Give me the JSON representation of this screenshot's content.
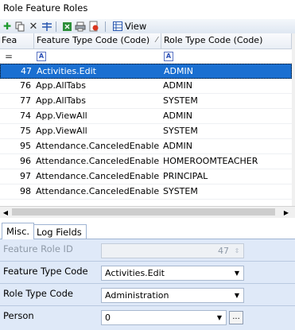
{
  "window": {
    "title": "Role Feature Roles"
  },
  "toolbar": {
    "view_label": "View"
  },
  "grid": {
    "headers": {
      "id": "Fea",
      "feature_type": "Feature Type Code (Code)",
      "role_type": "Role Type Code (Code)"
    },
    "filter": {
      "id": "=",
      "feature_type": "A",
      "role_type": "A"
    },
    "rows": [
      {
        "id": "47",
        "feature": "Activities.Edit",
        "role": "ADMIN",
        "selected": true
      },
      {
        "id": "76",
        "feature": "App.AllTabs",
        "role": "ADMIN"
      },
      {
        "id": "77",
        "feature": "App.AllTabs",
        "role": "SYSTEM"
      },
      {
        "id": "74",
        "feature": "App.ViewAll",
        "role": "ADMIN"
      },
      {
        "id": "75",
        "feature": "App.ViewAll",
        "role": "SYSTEM"
      },
      {
        "id": "95",
        "feature": "Attendance.CanceledEnabled",
        "role": "ADMIN"
      },
      {
        "id": "96",
        "feature": "Attendance.CanceledEnabled",
        "role": "HOMEROOMTEACHER"
      },
      {
        "id": "97",
        "feature": "Attendance.CanceledEnabled",
        "role": "PRINCIPAL"
      },
      {
        "id": "98",
        "feature": "Attendance.CanceledEnabled",
        "role": "SYSTEM"
      }
    ]
  },
  "tabs": {
    "misc": "Misc.",
    "log_fields": "Log Fields"
  },
  "form": {
    "feature_role_id": {
      "label": "Feature Role ID",
      "value": "47"
    },
    "feature_type_code": {
      "label": "Feature Type Code",
      "value": "Activities.Edit"
    },
    "role_type_code": {
      "label": "Role Type Code",
      "value": "Administration"
    },
    "person": {
      "label": "Person",
      "value": "0",
      "button": "..."
    }
  },
  "colors": {
    "selection": "#1a6fd1",
    "panel": "#dfe9f8"
  }
}
